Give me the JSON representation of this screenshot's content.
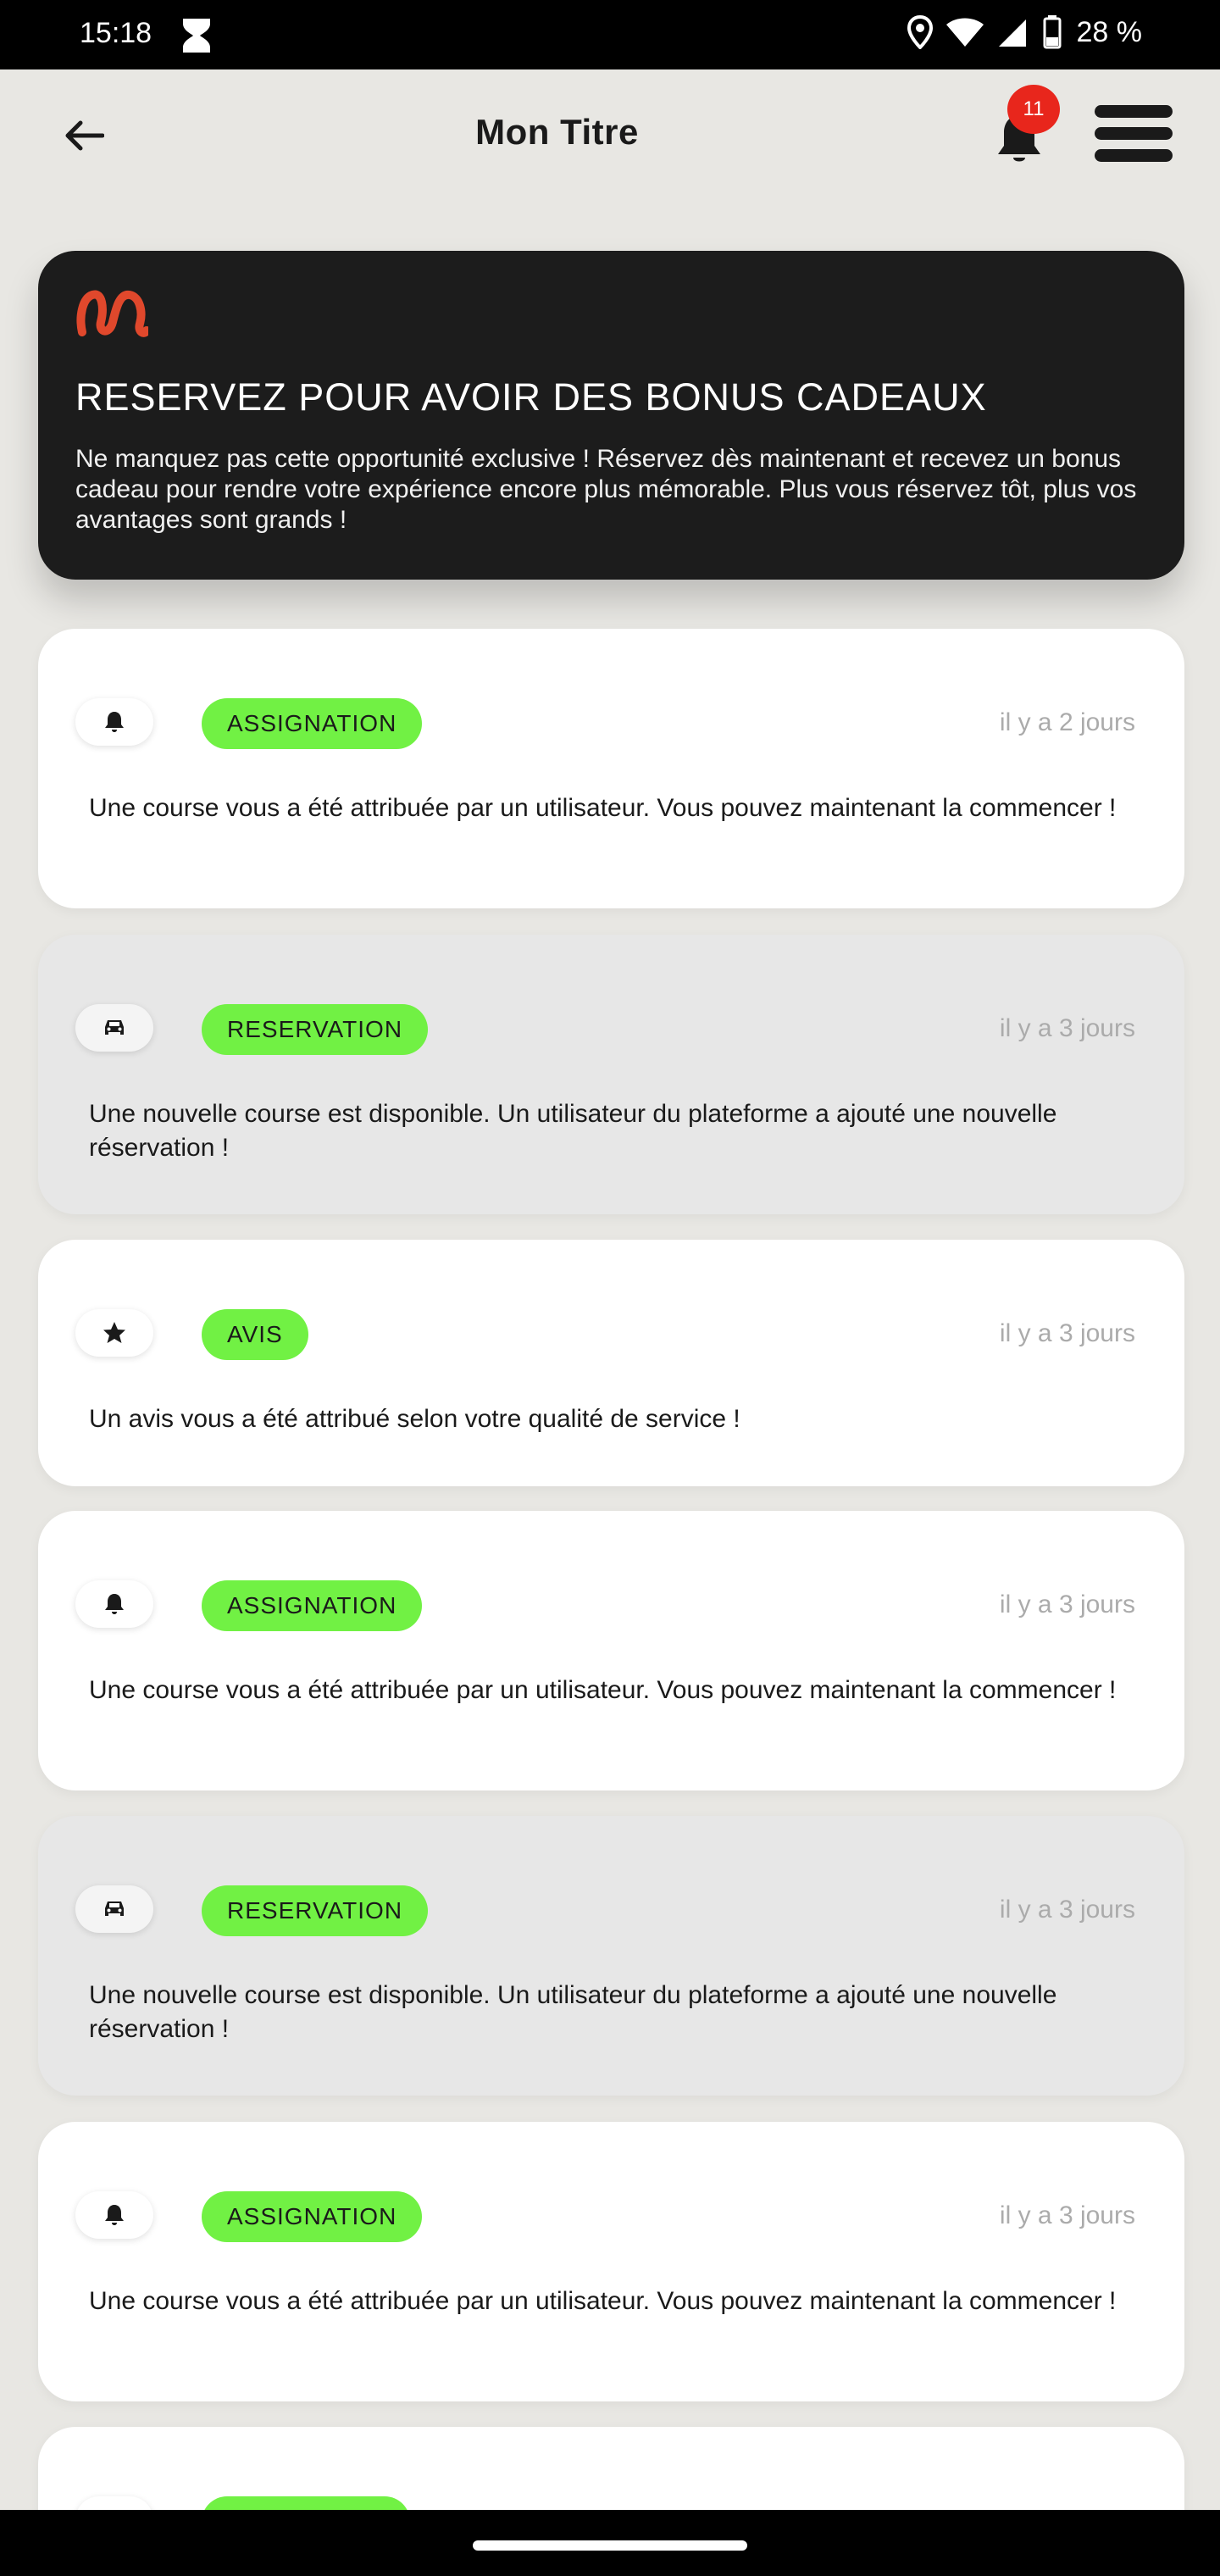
{
  "status_bar": {
    "time": "15:18",
    "battery": "28 %"
  },
  "header": {
    "title": "Mon Titre",
    "notification_count": "11"
  },
  "promo": {
    "title": "RESERVEZ POUR AVOIR DES BONUS CADEAUX",
    "text": "Ne manquez pas cette opportunité exclusive ! Réservez dès maintenant et recevez un bonus cadeau pour rendre votre expérience encore plus mémorable. Plus vous réservez tôt, plus vos avantages sont grands !",
    "brand_color": "#e0482c"
  },
  "notifications": [
    {
      "icon": "bell-icon",
      "tag": "ASSIGNATION",
      "time": "il y a 2 jours",
      "text": "Une course vous a été attribuée par un utilisateur. Vous pouvez maintenant la commencer !"
    },
    {
      "icon": "car-icon",
      "tag": "RESERVATION",
      "time": "il y a 3 jours",
      "text": "Une nouvelle course est disponible. Un utilisateur du plateforme a ajouté une nouvelle réservation !"
    },
    {
      "icon": "star-icon",
      "tag": "AVIS",
      "time": "il y a 3 jours",
      "text": "Un avis vous a été attribué selon votre qualité de service !"
    },
    {
      "icon": "bell-icon",
      "tag": "ASSIGNATION",
      "time": "il y a 3 jours",
      "text": "Une course vous a été attribuée par un utilisateur. Vous pouvez maintenant la commencer !"
    },
    {
      "icon": "car-icon",
      "tag": "RESERVATION",
      "time": "il y a 3 jours",
      "text": "Une nouvelle course est disponible. Un utilisateur du plateforme a ajouté une nouvelle réservation !"
    },
    {
      "icon": "bell-icon",
      "tag": "ASSIGNATION",
      "time": "il y a 3 jours",
      "text": "Une course vous a été attribuée par un utilisateur. Vous pouvez maintenant la commencer !"
    }
  ],
  "colors": {
    "tag_green": "#71f144",
    "badge_red": "#e8261c"
  }
}
